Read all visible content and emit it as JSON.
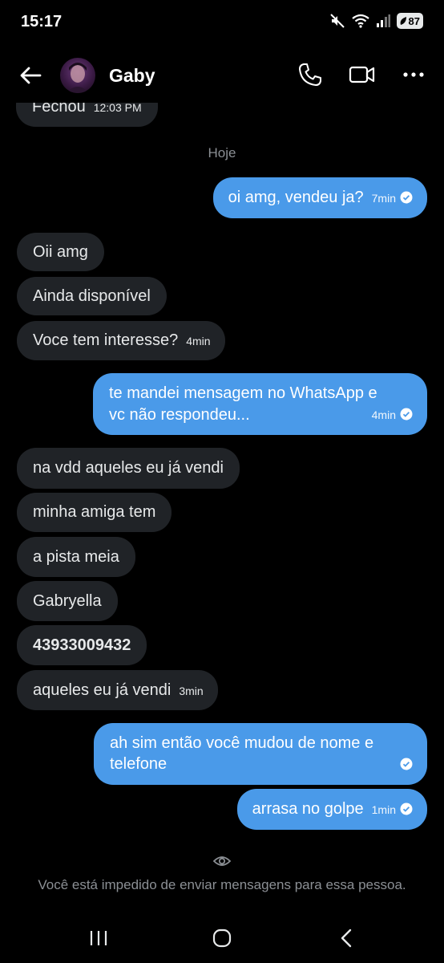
{
  "status": {
    "time": "15:17",
    "battery": "87"
  },
  "header": {
    "contact_name": "Gaby",
    "icons": [
      "back-arrow-icon",
      "phone-icon",
      "video-camera-icon",
      "more-dots-icon"
    ]
  },
  "chat": {
    "partial_message": {
      "text": "Fechou",
      "time": "12:03 PM"
    },
    "day_label": "Hoje",
    "messages": [
      {
        "dir": "out",
        "lines": [
          "oi amg, vendeu ja?"
        ],
        "time": "7min",
        "read": true
      },
      {
        "dir": "in",
        "lines": [
          "Oii amg"
        ],
        "time": ""
      },
      {
        "dir": "in",
        "lines": [
          "Ainda disponível"
        ],
        "time": ""
      },
      {
        "dir": "in",
        "lines": [
          "Voce tem interesse?"
        ],
        "time": "4min"
      },
      {
        "dir": "out",
        "lines": [
          "te mandei mensagem no WhatsApp e",
          "vc não respondeu..."
        ],
        "time": "4min",
        "read": true
      },
      {
        "dir": "in",
        "lines": [
          "na vdd aqueles eu já vendi"
        ],
        "time": ""
      },
      {
        "dir": "in",
        "lines": [
          "minha amiga tem"
        ],
        "time": ""
      },
      {
        "dir": "in",
        "lines": [
          "a pista meia"
        ],
        "time": ""
      },
      {
        "dir": "in",
        "lines": [
          "Gabryella"
        ],
        "time": ""
      },
      {
        "dir": "in",
        "lines": [
          "43933009432"
        ],
        "time": "",
        "bold": true
      },
      {
        "dir": "in",
        "lines": [
          "aqueles eu já vendi"
        ],
        "time": "3min"
      },
      {
        "dir": "out",
        "lines": [
          "ah sim então você mudou de nome e",
          "telefone"
        ],
        "time": "",
        "read": true
      },
      {
        "dir": "out",
        "lines": [
          "arrasa no golpe"
        ],
        "time": "1min",
        "read": true
      }
    ]
  },
  "footer": {
    "blocked_notice": "Você está impedido de enviar mensagens para essa pessoa."
  },
  "colors": {
    "background": "#000000",
    "incoming_bubble": "#202327",
    "outgoing_bubble": "#4a9ae9",
    "secondary_text": "#8b8f94"
  }
}
